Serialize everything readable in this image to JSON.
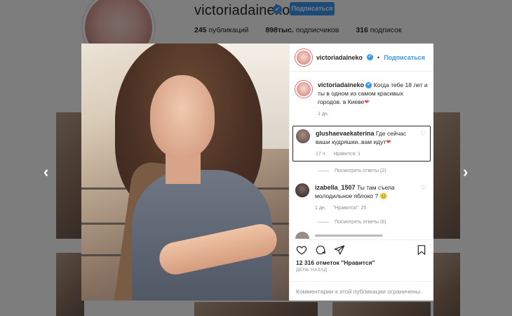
{
  "profile": {
    "username": "victoriadaineko",
    "follow_label": "Подписаться",
    "verified_glyph": "✔",
    "stats": {
      "posts_count": "245",
      "posts_label": "публикаций",
      "followers_count": "898тыс.",
      "followers_label": "подписчиков",
      "following_count": "316",
      "following_label": "подписок"
    }
  },
  "nav": {
    "prev_icon": "chevron-left-icon",
    "next_icon": "chevron-right-icon",
    "prev_glyph": "‹",
    "next_glyph": "›"
  },
  "post": {
    "header_username": "victoriadaineko",
    "header_separator": "•",
    "header_follow": "Подписаться",
    "caption": {
      "username": "victoriadaineko",
      "text": "Когда тебе 18 лет и ты в одном из самом красивых городов. в Киеве",
      "heart": "❤",
      "time": "1 дн."
    },
    "comments": [
      {
        "username": "glushaevaekaterina",
        "text": "Где сейчас ваши кудряшки..вам идут",
        "heart": "❤",
        "time": "17 ч.",
        "likes": "Нравится: 1",
        "replies": "Посмотреть ответы (2)"
      },
      {
        "username": "izabella_1507",
        "text": "Ты там съела молодильное яблоко ?",
        "emoji": "😊",
        "time": "1 дн.",
        "likes": "\"Нравится\": 25",
        "replies": "Посмотреть ответы (6)"
      }
    ],
    "likes": "12 316 отметок \"Нравится\"",
    "posted_ago": "ДЕНЬ НАЗАД",
    "comments_closed": "Комментарии к этой публикации ограничены."
  },
  "colors": {
    "accent": "#3897f0",
    "heart_red": "#ed4956"
  }
}
